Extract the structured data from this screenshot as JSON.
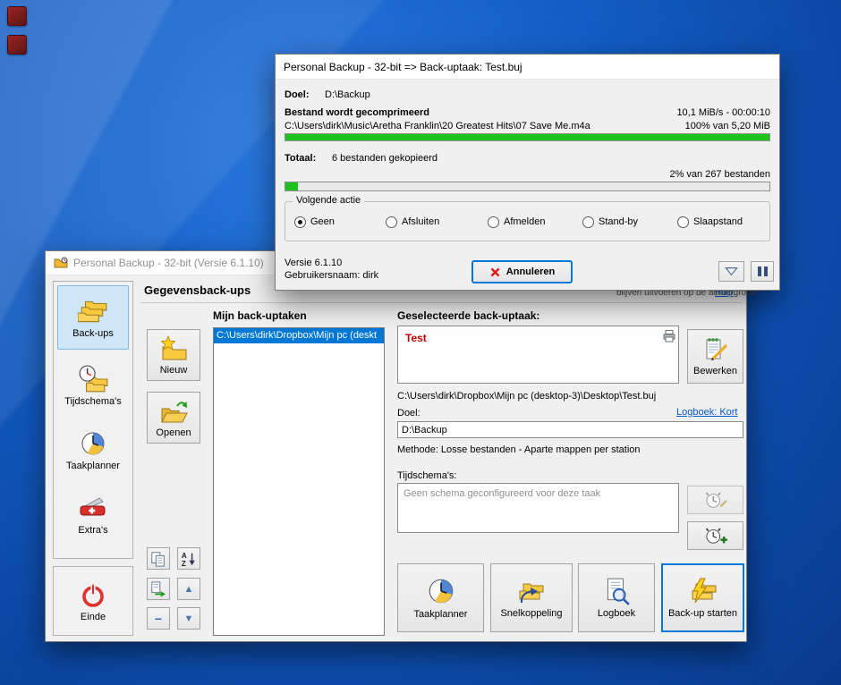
{
  "colors": {
    "selection_blue": "#0078d7",
    "progress_green": "#1dc31d",
    "task_name_red": "#c00000",
    "desktop_blue": "#135fc7"
  },
  "icons": {
    "up_arrow": "▲",
    "down_arrow": "▼",
    "remove": "−",
    "dropdown_arrow": "▼"
  },
  "main_window": {
    "title": "Personal Backup - 32-bit (Versie 6.1.10)",
    "tab_label": "Gegevensback-ups",
    "background_fragment": "blijven uitvoeren op de achtergrond",
    "help_link": "Hulp",
    "sidebar": {
      "items": [
        {
          "label": "Back-ups"
        },
        {
          "label": "Tijdschema's"
        },
        {
          "label": "Taakplanner"
        },
        {
          "label": "Extra's"
        }
      ],
      "exit_label": "Einde"
    },
    "tasks": {
      "heading": "Mijn back-uptaken",
      "new_button": "Nieuw",
      "open_button": "Openen",
      "selected_item": "C:\\Users\\dirk\\Dropbox\\Mijn pc (deskt"
    },
    "selected_task": {
      "heading": "Geselecteerde back-uptaak:",
      "name": "Test",
      "file_path": "C:\\Users\\dirk\\Dropbox\\Mijn pc (desktop-3)\\Desktop\\Test.buj",
      "edit_button": "Bewerken",
      "target_label": "Doel:",
      "log_link": "Logboek: Kort",
      "target_value": "D:\\Backup",
      "method_line": "Methode: Losse bestanden - Aparte mappen per station",
      "schedules_label": "Tijdschema's:",
      "schedule_empty": "Geen schema geconfigureerd voor deze taak"
    },
    "action_buttons": [
      {
        "label": "Taakplanner"
      },
      {
        "label": "Snelkoppeling"
      },
      {
        "label": "Logboek"
      },
      {
        "label": "Back-up starten"
      }
    ]
  },
  "progress_window": {
    "title": "Personal Backup - 32-bit => Back-uptaak: Test.buj",
    "target_label": "Doel:",
    "target_value": "D:\\Backup",
    "status_text": "Bestand wordt gecomprimeerd",
    "speed_text": "10,1 MiB/s - 00:00:10",
    "current_file": "C:\\Users\\dirk\\Music\\Aretha Franklin\\20 Greatest Hits\\07 Save Me.m4a",
    "file_progress_text": "100% van 5,20 MiB",
    "file_progress_pct": 100,
    "total_label": "Totaal:",
    "total_text": "6 bestanden gekopieerd",
    "total_progress_text": "2% van 267 bestanden",
    "total_progress_pct": 2.5,
    "next_action": {
      "legend": "Volgende actie",
      "options": [
        "Geen",
        "Afsluiten",
        "Afmelden",
        "Stand-by",
        "Slaapstand"
      ],
      "selected": "Geen"
    },
    "version_text": "Versie 6.1.10",
    "user_text": "Gebruikersnaam: dirk",
    "cancel_button": "Annuleren"
  }
}
